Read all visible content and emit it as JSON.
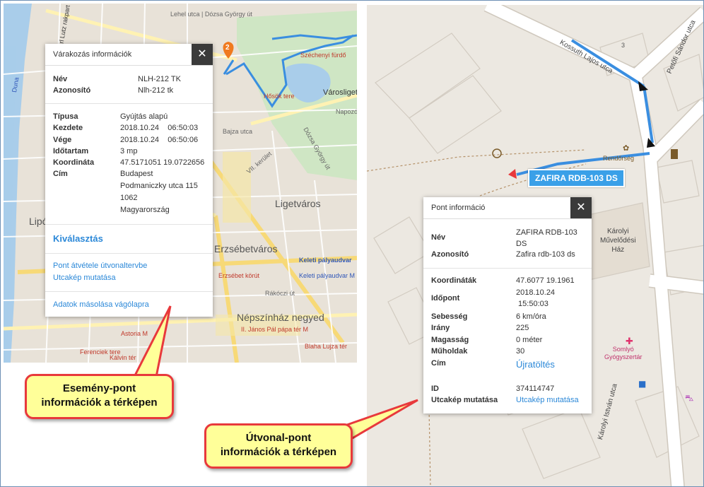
{
  "event_popup": {
    "title": "Várakozás információk",
    "close": "✕",
    "name_label": "Név",
    "name_value": "NLH-212 TK",
    "id_label": "Azonosító",
    "id_value": "Nlh-212 tk",
    "type_label": "Típusa",
    "type_value": "Gyújtás alapú",
    "start_label": "Kezdete",
    "start_value": "2018.10.24    06:50:03",
    "end_label": "Vége",
    "end_value": "2018.10.24    06:50:06",
    "duration_label": "Időtartam",
    "duration_value": "3 mp",
    "coord_label": "Koordináta",
    "coord_value": "47.5171051 19.0722656",
    "address_label": "Cím",
    "address_lines": [
      "Budapest",
      "Podmaniczky utca 115",
      "1062",
      "Magyarország"
    ],
    "select_link": "Kiválasztás",
    "route_link": "Pont átvétele útvonaltervbe",
    "streetview_link": "Utcakép mutatása",
    "copy_link": "Adatok másolása vágólapra"
  },
  "route_popup": {
    "title": "Pont információ",
    "close": "✕",
    "name_label": "Név",
    "name_lines": [
      "ZAFIRA RDB-103",
      "DS"
    ],
    "id_label": "Azonosító",
    "id_value": "Zafira rdb-103 ds",
    "coords_label": "Koordináták",
    "coords_value": "47.6077 19.1961",
    "time_label": "Időpont",
    "time_lines": [
      "2018.10.24",
      " 15:50:03"
    ],
    "speed_label": "Sebesség",
    "speed_value": "6 km/óra",
    "dir_label": "Irány",
    "dir_value": "225",
    "alt_label": "Magasság",
    "alt_value": "0 méter",
    "sat_label": "Műholdak",
    "sat_value": "30",
    "addr_label": "Cím",
    "reload_link": "Újratöltés",
    "pid_label": "ID",
    "pid_value": "374114747",
    "sv_label": "Utcakép mutatása",
    "sv_link": "Utcakép mutatása"
  },
  "vehicle_tag": "ZAFIRA RDB-103 DS",
  "marker_number": "2",
  "callouts": {
    "event": [
      "Esemény-pont",
      "információk a térképen"
    ],
    "route": [
      "Útvonal-pont",
      "információk a térképen"
    ]
  },
  "left_map_labels": {
    "ligetvaros": "Ligetváros",
    "erzsebetvaros": "Erzsébetváros",
    "nepszinhaz": "Népszínház negyed",
    "varosliget": "Városliget",
    "keleti": "Keleti pályaudvar",
    "keleti_m": "Keleti pályaudvar M",
    "lipo": "Lipó",
    "dozsa": "Dózsa György út",
    "bajza": "Bajza utca",
    "napozo": "Napozó",
    "szechenyi": "Széchenyi fürdő",
    "hosok": "Hősök tere",
    "lehel": "Lehel utca | Dózsa György út",
    "carl": "Carl Lutz rakpart",
    "vii": "VII. kerület",
    "erzsebet_korut": "Erzsébet körút",
    "rakoczi": "Rákóczi út",
    "astoria": "Astoria M",
    "ferenciek": "Ferenciek tere",
    "kalvin": "Kálvin tér",
    "janos_pal": "II. János Pál pápa tér M",
    "blaha": "Blaha Lujza tér",
    "duna": "Duna"
  },
  "right_map_labels": {
    "kossuth": "Kossuth Lajos utca",
    "petofi": "Petőfi Sándor utca",
    "karolyi_istvan": "Károlyi István utca",
    "karolyi_hall": [
      "Károlyi",
      "Művelődési",
      "Ház"
    ],
    "somlyo": [
      "Somlyó",
      "Gyógyszertár"
    ],
    "kendorseg": "Rendőrség",
    "house3": "3",
    "badge": "2"
  },
  "colors": {
    "route_line": "#3a8ee0",
    "callout_border": "#e8393c",
    "callout_fill": "#ffff99",
    "link": "#2b88d8",
    "close_bg": "#3a3a3a"
  }
}
